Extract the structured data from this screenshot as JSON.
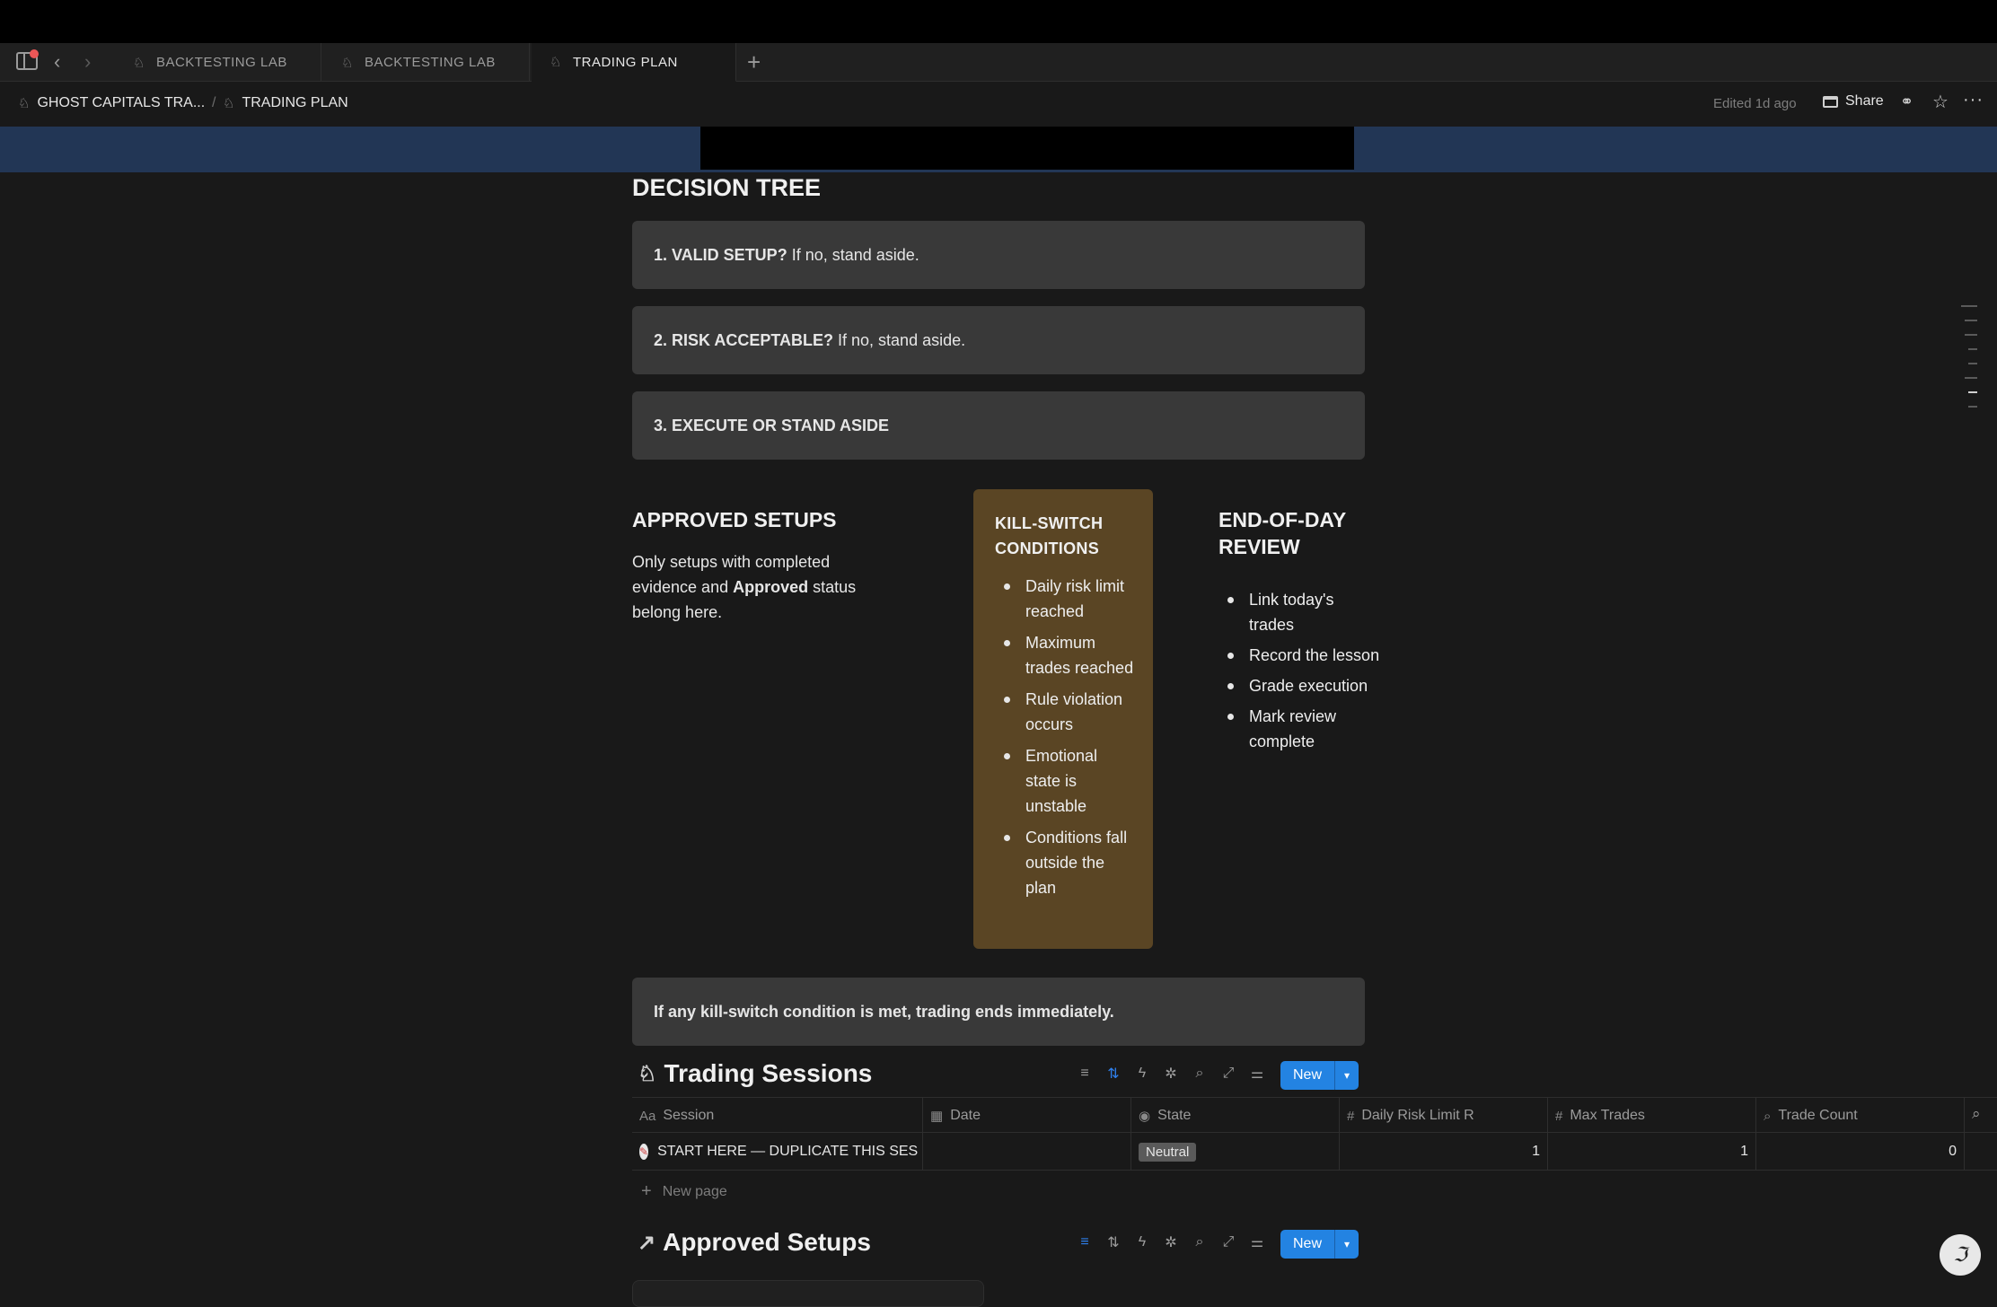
{
  "tabs": [
    {
      "label": "BACKTESTING LAB",
      "icon": "ghost-icon"
    },
    {
      "label": "BACKTESTING LAB",
      "icon": "ghost-icon"
    },
    {
      "label": "TRADING PLAN",
      "icon": "ghost-icon",
      "active": true
    }
  ],
  "breadcrumb": {
    "root": "GHOST CAPITALS TRA...",
    "separator": "/",
    "current": "TRADING PLAN"
  },
  "header": {
    "edited": "Edited 1d ago",
    "share_label": "Share"
  },
  "decision_tree": {
    "heading": "DECISION TREE",
    "steps": [
      {
        "bold": "1. VALID SETUP?",
        "text": "If no, stand aside."
      },
      {
        "bold": "2. RISK ACCEPTABLE?",
        "text": "If no, stand aside."
      },
      {
        "bold": "3. EXECUTE OR STAND ASIDE",
        "text": ""
      }
    ]
  },
  "approved_setups": {
    "heading": "APPROVED SETUPS",
    "text_before": "Only setups with completed evidence and ",
    "text_bold": "Approved",
    "text_after": " status belong here."
  },
  "kill_switch": {
    "heading": "KILL-SWITCH CONDITIONS",
    "items": [
      "Daily risk limit reached",
      "Maximum trades reached",
      "Rule violation occurs",
      "Emotional state is unstable",
      "Conditions fall outside the plan"
    ]
  },
  "end_of_day": {
    "heading": "END-OF-DAY REVIEW",
    "items": [
      "Link today's trades",
      "Record the lesson",
      "Grade execution",
      "Mark review complete"
    ]
  },
  "final_callout": "If any kill-switch condition is met, trading ends immediately.",
  "trading_sessions": {
    "title": "Trading Sessions",
    "new_label": "New",
    "columns": [
      {
        "label": "Session",
        "icon": "Aa"
      },
      {
        "label": "Date",
        "icon": "calendar-icon"
      },
      {
        "label": "State",
        "icon": "status-icon"
      },
      {
        "label": "Daily Risk Limit R",
        "icon": "#"
      },
      {
        "label": "Max Trades",
        "icon": "#"
      },
      {
        "label": "Trade Count",
        "icon": "search-icon"
      }
    ],
    "rows": [
      {
        "session": "START HERE — DUPLICATE THIS SES",
        "date": "",
        "state": "Neutral",
        "daily_risk_limit_r": "1",
        "max_trades": "1",
        "trade_count": "0"
      }
    ],
    "new_page_label": "New page"
  },
  "approved_setups_db": {
    "title": "Approved Setups",
    "new_label": "New"
  },
  "colors": {
    "accent": "#2383e2",
    "kill_switch_bg": "#5a4524",
    "cover": "#223655",
    "callout_bg": "#393939"
  }
}
